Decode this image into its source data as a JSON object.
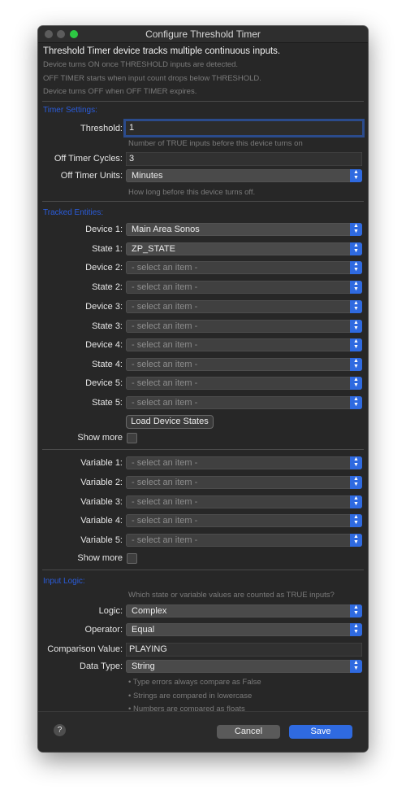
{
  "window": {
    "title": "Configure Threshold Timer"
  },
  "intro": {
    "title": "Threshold Timer device tracks multiple continuous inputs.",
    "lines": [
      "Device turns ON once THRESHOLD inputs are detected.",
      "OFF TIMER starts when input count drops below THRESHOLD.",
      "Device turns OFF when OFF TIMER expires."
    ]
  },
  "timer_settings": {
    "heading": "Timer Settings:",
    "threshold_label": "Threshold:",
    "threshold_value": "1",
    "threshold_hint": "Number of TRUE inputs before this device turns on",
    "off_cycles_label": "Off Timer Cycles:",
    "off_cycles_value": "3",
    "off_units_label": "Off Timer Units:",
    "off_units_value": "Minutes",
    "off_units_hint": "How long before this device turns off."
  },
  "tracked": {
    "heading": "Tracked Entities:",
    "rows": [
      {
        "label": "Device 1:",
        "value": "Main Area Sonos"
      },
      {
        "label": "State 1:",
        "value": "ZP_STATE"
      },
      {
        "label": "Device 2:",
        "value": "- select an item -"
      },
      {
        "label": "State 2:",
        "value": "- select an item -"
      },
      {
        "label": "Device 3:",
        "value": "- select an item -"
      },
      {
        "label": "State 3:",
        "value": "- select an item -"
      },
      {
        "label": "Device 4:",
        "value": "- select an item -"
      },
      {
        "label": "State 4:",
        "value": "- select an item -"
      },
      {
        "label": "Device 5:",
        "value": "- select an item -"
      },
      {
        "label": "State 5:",
        "value": "- select an item -"
      }
    ],
    "load_button": "Load Device States",
    "show_more_label": "Show more"
  },
  "variables": {
    "rows": [
      {
        "label": "Variable 1:",
        "value": "- select an item -"
      },
      {
        "label": "Variable 2:",
        "value": "- select an item -"
      },
      {
        "label": "Variable 3:",
        "value": "- select an item -"
      },
      {
        "label": "Variable 4:",
        "value": "- select an item -"
      },
      {
        "label": "Variable 5:",
        "value": "- select an item -"
      }
    ],
    "show_more_label": "Show more"
  },
  "input_logic": {
    "heading": "Input Logic:",
    "hint": "Which state or variable values are counted as TRUE inputs?",
    "logic_label": "Logic:",
    "logic_value": "Complex",
    "operator_label": "Operator:",
    "operator_value": "Equal",
    "comparison_label": "Comparison Value:",
    "comparison_value": "PLAYING",
    "data_type_label": "Data Type:",
    "data_type_value": "String",
    "notes": [
      "• Type errors always compare as False",
      "• Strings are compared in lowercase",
      "• Numbers are compared as floats"
    ]
  },
  "footer": {
    "help_label": "?",
    "cancel_label": "Cancel",
    "save_label": "Save"
  },
  "colors": {
    "accent": "#2f6ae0",
    "section_heading": "#2a5cdb",
    "window_bg": "#272727"
  }
}
